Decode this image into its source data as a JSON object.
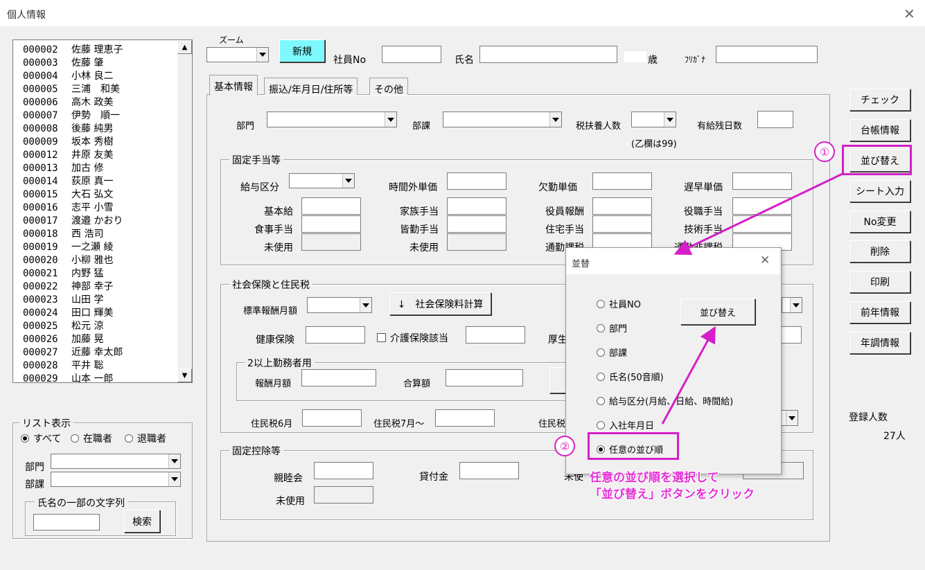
{
  "window": {
    "title": "個人情報",
    "close": "✕"
  },
  "employee_list": [
    {
      "no": "000002",
      "name": "佐藤 理恵子"
    },
    {
      "no": "000003",
      "name": "佐藤 肇"
    },
    {
      "no": "000004",
      "name": "小林 良二"
    },
    {
      "no": "000005",
      "name": "三浦　和美"
    },
    {
      "no": "000006",
      "name": "高木 政美"
    },
    {
      "no": "000007",
      "name": "伊勢　順一"
    },
    {
      "no": "000008",
      "name": "後藤 純男"
    },
    {
      "no": "000009",
      "name": "坂本 秀樹"
    },
    {
      "no": "000012",
      "name": "井原 友美"
    },
    {
      "no": "000013",
      "name": "加古 修"
    },
    {
      "no": "000014",
      "name": "荻原 真一"
    },
    {
      "no": "000015",
      "name": "大石 弘文"
    },
    {
      "no": "000016",
      "name": "志平 小雪"
    },
    {
      "no": "000017",
      "name": "渡邉 かおり"
    },
    {
      "no": "000018",
      "name": "西 浩司"
    },
    {
      "no": "000019",
      "name": "一之瀬 綾"
    },
    {
      "no": "000020",
      "name": "小柳 雅也"
    },
    {
      "no": "000021",
      "name": "内野 猛"
    },
    {
      "no": "000022",
      "name": "神部 幸子"
    },
    {
      "no": "000023",
      "name": "山田 学"
    },
    {
      "no": "000024",
      "name": "田口 輝美"
    },
    {
      "no": "000025",
      "name": "松元 涼"
    },
    {
      "no": "000026",
      "name": "加藤 晃"
    },
    {
      "no": "000027",
      "name": "近藤 幸太郎"
    },
    {
      "no": "000028",
      "name": "平井 聡"
    },
    {
      "no": "000029",
      "name": "山本 一郎"
    }
  ],
  "list_display": {
    "title": "リスト表示",
    "options": [
      "すべて",
      "在職者",
      "退職者"
    ],
    "selected": "すべて",
    "dept_label": "部門",
    "section_label": "部課",
    "name_part_title": "氏名の一部の文字列",
    "search_button": "検索"
  },
  "header": {
    "zoom_label": "ズーム",
    "new_button": "新規",
    "employee_no_label": "社員No",
    "name_label": "氏名",
    "age_label": "歳",
    "furigana_label": "ﾌﾘｶﾞﾅ"
  },
  "tabs": [
    "基本情報",
    "振込/年月日/住所等",
    "その他"
  ],
  "basic": {
    "dept_label": "部門",
    "section_label": "部課",
    "tax_dependents_label": "税扶養人数",
    "paid_leave_label": "有給残日数",
    "otsu_note": "(乙欄は99)"
  },
  "fixed_allowance": {
    "title": "固定手当等",
    "pay_class_label": "給与区分",
    "overtime_label": "時間外単価",
    "absence_label": "欠勤単価",
    "late_label": "遅早単価",
    "base_pay_label": "基本給",
    "family_label": "家族手当",
    "officer_label": "役員報酬",
    "position_label": "役職手当",
    "meal_label": "食事手当",
    "attendance_label": "皆勤手当",
    "housing_label": "住宅手当",
    "skill_label": "技術手当",
    "unused1": "未使用",
    "unused2": "未使用",
    "commute_tax_label": "通勤課税",
    "commute_non_tax_label": "通勤非課税"
  },
  "social": {
    "title": "社会保険と住民税",
    "std_monthly_label": "標準報酬月額",
    "calc_button": "↓　社会保険料計算",
    "health_label": "健康保険",
    "care_label": "介護保険該当",
    "pension_label": "厚生",
    "multi_title": "2以上勤務者用",
    "monthly_label": "報酬月額",
    "total_label": "合算額",
    "resident_june_label": "住民税6月",
    "resident_july_label": "住民税7月～",
    "resident_tax_label": "住民税"
  },
  "fixed_deduction": {
    "title": "固定控除等",
    "social_club_label": "親睦会",
    "loan_label": "貸付金",
    "unused_right": "未使",
    "unused_label": "未使用"
  },
  "right_buttons": [
    "チェック",
    "台帳情報",
    "並び替え",
    "シート入力",
    "No変更",
    "削除",
    "印刷",
    "前年情報",
    "年調情報"
  ],
  "registered": {
    "label": "登録人数",
    "count": "27人"
  },
  "sort_dialog": {
    "title": "並替",
    "close": "✕",
    "options": [
      "社員NO",
      "部門",
      "部課",
      "氏名(50音順)",
      "給与区分(月給、日給、時間給)",
      "入社年月日",
      "任意の並び順"
    ],
    "selected": "任意の並び順",
    "sort_button": "並び替え"
  },
  "annotation": {
    "step1": "①",
    "step2": "②",
    "line1": "任意の並び順を選択して",
    "line2": "「並び替え」ボタンをクリック",
    "color": "#d51fc8"
  }
}
